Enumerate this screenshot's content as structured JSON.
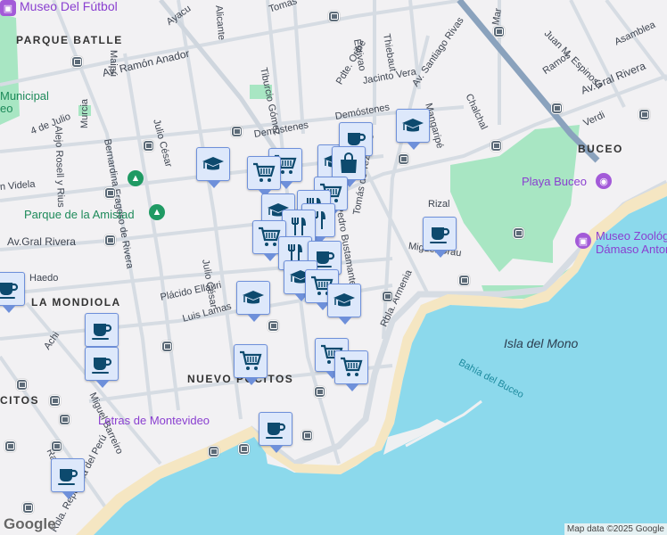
{
  "areas": {
    "parque_batlle": "PARQUE BATLLE",
    "la_mondiola": "LA MONDIOLA",
    "nuevo_pocitos": "NUEVO POCITOS",
    "buceo": "BUCEO",
    "pocitos": "CITOS"
  },
  "streets": {
    "ramon_anador": "Av. Ramón Anador",
    "gral_rivera_w": "Av.Gral Rivera",
    "gral_rivera_e": "Av.Gral Rivera",
    "cuatro_julio": "4 de Julio",
    "alejo": "Alejo Rosell y Rius",
    "murcia": "Murcia",
    "maipu": "Maipú",
    "bernardina": "Bernardina Fragoso de Rivera",
    "julio_cesar": "Julio César",
    "julio_cesar2": "Julio César",
    "tiburcio": "Tiburcio Gómez",
    "pdte_oribe": "Pdte. Oribe",
    "estivao": "Estivao",
    "thiebaut": "Thiebaut",
    "jacinto": "Jacinto Vera",
    "santiago": "Av. Santiago Rivas",
    "demostenes": "Demóstenes",
    "demostenes2": "Demóstenes",
    "mangaripe": "Mangaripé",
    "chalchal": "Chalchal",
    "juan_espinosa": "Juan M. Espinosa",
    "ramos": "Ramos",
    "asamblea": "Asamblea",
    "verdi": "Verdi",
    "rizal": "Rizal",
    "tezanos": "Tomás de Tezanos",
    "bustamante": "Pedro Bustamante",
    "miguel_grau": "Miguel Grau",
    "placido": "Plácido Ellauri",
    "luis_lamas": "Luis Lamas",
    "haedo": "Haedo",
    "videla": "n Videla",
    "armenia": "Rbla. Armenia",
    "peru": "Rbla. República del Perú",
    "miguel_barreiro": "Miguel Barreiro",
    "tomas": "Tomas",
    "alicante": "Alicante",
    "ayacucho": "Ayacu",
    "ambrosio": "Mar",
    "achi": "Achi",
    "ramon": "Ram"
  },
  "pois": {
    "museo_futbol": "Museo Del Fútbol",
    "parque_amistad": "Parque de la Amistad",
    "municipal": "Municipal",
    "municipal2": "eo",
    "playa_buceo": "Playa Buceo",
    "museo_zoo1": "Museo Zoológico",
    "museo_zoo2": "Dámaso Antonio",
    "letras": "Letras de Montevideo"
  },
  "water": {
    "bahia": "Bahía del Buceo",
    "isla": "Isla del Mono"
  },
  "attribution": "Map data ©2025 Google",
  "logo": "Google",
  "colors": {
    "water": "#8cd9ec",
    "park": "#a8e6c3",
    "road": "#d5dbe2",
    "marker_bg": "#dde8fb",
    "marker_border": "#6e90da",
    "icon": "#0d4a6e"
  }
}
